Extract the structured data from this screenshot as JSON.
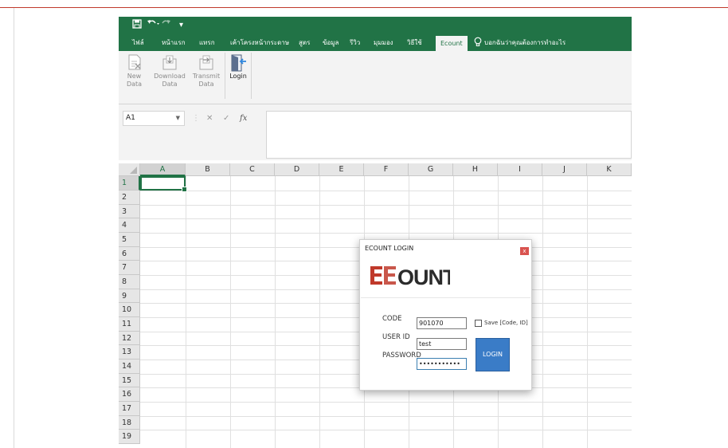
{
  "quick_access": {
    "save_icon": "save-icon",
    "undo_icon": "undo-icon",
    "redo_icon": "redo-icon",
    "customize_icon": "customize-icon"
  },
  "tabs": [
    {
      "label": "ไฟล์"
    },
    {
      "label": "หน้าแรก"
    },
    {
      "label": "แทรก"
    },
    {
      "label": "เค้าโครงหน้ากระดาษ"
    },
    {
      "label": "สูตร"
    },
    {
      "label": "ข้อมูล"
    },
    {
      "label": "รีวิว"
    },
    {
      "label": "มุมมอง"
    },
    {
      "label": "วิธีใช้"
    },
    {
      "label": "Ecount"
    }
  ],
  "tell_me": "บอกฉันว่าคุณต้องการทำอะไร",
  "ribbon": {
    "buttons": [
      {
        "line1": "New",
        "line2": "Data",
        "enabled": false
      },
      {
        "line1": "Download",
        "line2": "Data",
        "enabled": false
      },
      {
        "line1": "Transmit",
        "line2": "Data",
        "enabled": false
      },
      {
        "line1": "Login",
        "line2": "",
        "enabled": true
      }
    ]
  },
  "formula_bar": {
    "name_box": "A1",
    "cancel": "✕",
    "enter": "✓",
    "fx": "fx",
    "content": ""
  },
  "columns": [
    "A",
    "B",
    "C",
    "D",
    "E",
    "F",
    "G",
    "H",
    "I",
    "J",
    "K"
  ],
  "rows": [
    "1",
    "2",
    "3",
    "4",
    "5",
    "6",
    "7",
    "8",
    "9",
    "10",
    "11",
    "12",
    "13",
    "14",
    "15",
    "16",
    "17",
    "18",
    "19"
  ],
  "selected_cell": "A1",
  "login_dialog": {
    "title": "ECOUNT LOGIN",
    "close": "x",
    "logo_text": "ECOUNT",
    "code_label": "CODE",
    "code_value": "901070",
    "user_label": "USER ID",
    "user_value": "test",
    "password_label": "PASSWORD",
    "password_value": "•••••••••••",
    "save_label": "Save [Code, ID]",
    "save_checked": false,
    "login_button": "LOGIN"
  },
  "colors": {
    "excel_green": "#217346",
    "login_blue": "#3a7cc7",
    "close_red": "#d9534f"
  }
}
